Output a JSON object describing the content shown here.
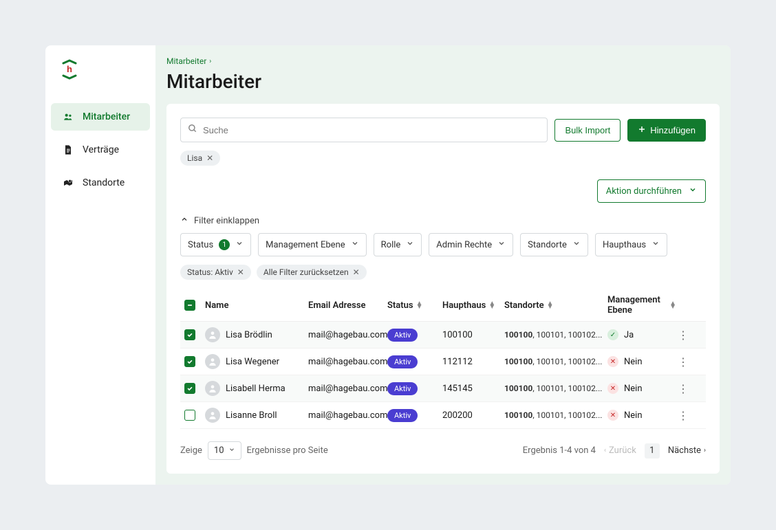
{
  "sidebar": {
    "items": [
      {
        "label": "Mitarbeiter",
        "icon": "people",
        "active": true
      },
      {
        "label": "Verträge",
        "icon": "document",
        "active": false
      },
      {
        "label": "Standorte",
        "icon": "map-pin",
        "active": false
      }
    ]
  },
  "breadcrumb": {
    "label": "Mitarbeiter"
  },
  "header": {
    "title": "Mitarbeiter"
  },
  "toolbar": {
    "search_placeholder": "Suche",
    "search_value": "",
    "bulk_import": "Bulk Import",
    "add": "Hinzufügen",
    "search_chip": "Lisa"
  },
  "actions": {
    "perform_label": "Aktion durchführen"
  },
  "filters": {
    "collapse_label": "Filter einklappen",
    "status_label": "Status",
    "status_count": "1",
    "mgmt_label": "Management Ebene",
    "role_label": "Rolle",
    "admin_label": "Admin Rechte",
    "locations_label": "Standorte",
    "main_label": "Haupthaus",
    "active_chip_status": "Status: Aktiv",
    "active_chip_reset": "Alle Filter zurücksetzen"
  },
  "table": {
    "columns": {
      "name": "Name",
      "email": "Email Adresse",
      "status": "Status",
      "haupthaus": "Haupthaus",
      "standorte": "Standorte",
      "mgmt": "Management Ebene"
    },
    "rows": [
      {
        "checked": true,
        "name": "Lisa Brödlin",
        "email": "mail@hagebau.com",
        "status": "Aktiv",
        "haupthaus": "100100",
        "loc_primary": "100100",
        "loc_rest": ", 100101, 100102...",
        "mgmt_value": "Ja",
        "mgmt_yes": true
      },
      {
        "checked": true,
        "name": "Lisa Wegener",
        "email": "mail@hagebau.com",
        "status": "Aktiv",
        "haupthaus": "112112",
        "loc_primary": "100100",
        "loc_rest": ", 100101, 100102...",
        "mgmt_value": "Nein",
        "mgmt_yes": false
      },
      {
        "checked": true,
        "name": "Lisabell Herma",
        "email": "mail@hagebau.com",
        "status": "Aktiv",
        "haupthaus": "145145",
        "loc_primary": "100100",
        "loc_rest": ", 100101, 100102...",
        "mgmt_value": "Nein",
        "mgmt_yes": false
      },
      {
        "checked": false,
        "name": "Lisanne Broll",
        "email": "mail@hagebau.com",
        "status": "Aktiv",
        "haupthaus": "200200",
        "loc_primary": "100100",
        "loc_rest": ", 100101, 100102...",
        "mgmt_value": "Nein",
        "mgmt_yes": false
      }
    ]
  },
  "pager": {
    "show_label": "Zeige",
    "page_size": "10",
    "per_page_label": "Ergebnisse pro Seite",
    "result_range": "Ergebnis 1-4 von 4",
    "prev": "Zurück",
    "current_page": "1",
    "next": "Nächste"
  },
  "colors": {
    "accent": "#127a2e",
    "pill": "#4a3dd1"
  }
}
